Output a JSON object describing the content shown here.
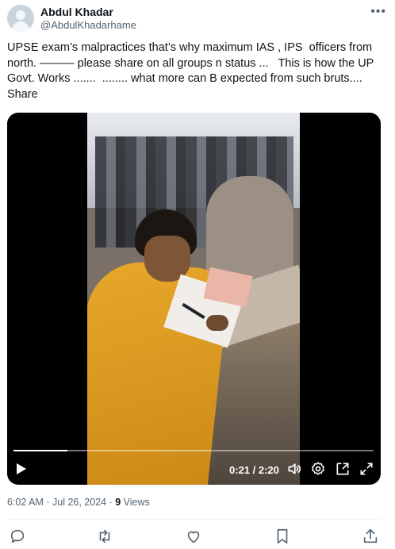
{
  "author": {
    "name": "Abdul Khadar",
    "handle": "@AbdulKhadarhame"
  },
  "more_icon": "ellipsis-icon",
  "tweet": {
    "text": "UPSE exam’s malpractices that’s why maximum IAS , IPS  officers from north. ——— please share on all groups n status ...   This is how the UP Govt. Works .......  ........ what more can B expected from such bruts.... Share"
  },
  "video": {
    "current_time": "0:21",
    "duration": "2:20",
    "time_display": "0:21 / 2:20",
    "progress": 0.15,
    "controls": [
      "play-icon",
      "volume-icon",
      "settings-icon",
      "pip-icon",
      "fullscreen-icon"
    ]
  },
  "meta": {
    "time": "6:02 AM",
    "date": "Jul 26, 2024",
    "views_count": "9",
    "views_label": "Views"
  },
  "actions": [
    "reply-icon",
    "retweet-icon",
    "like-icon",
    "bookmark-icon",
    "share-icon"
  ],
  "colors": {
    "text": "#0f1419",
    "secondary": "#536471",
    "divider": "#eff3f4"
  }
}
